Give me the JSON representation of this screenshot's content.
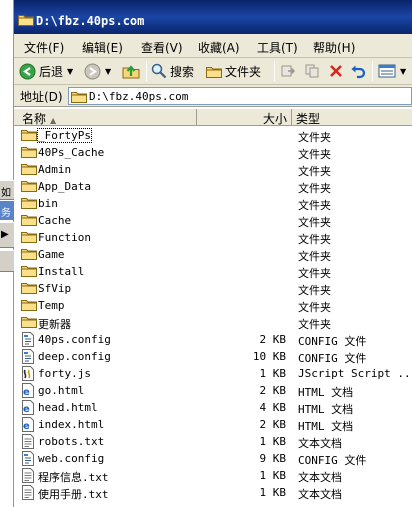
{
  "window": {
    "title": "D:\\fbz.40ps.com"
  },
  "background_strip": {
    "chars": [
      "如",
      "务"
    ]
  },
  "menu": [
    "文件(F)",
    "编辑(E)",
    "查看(V)",
    "收藏(A)",
    "工具(T)",
    "帮助(H)"
  ],
  "toolbar": {
    "back_label": "后退",
    "search_label": "搜索",
    "folders_label": "文件夹"
  },
  "address": {
    "label": "地址(D)",
    "value": "D:\\fbz.40ps.com"
  },
  "columns": {
    "name": "名称",
    "size": "大小",
    "type": "类型"
  },
  "files": [
    {
      "name": "_FortyPs",
      "size": "",
      "type": "文件夹",
      "icon": "folder-icon"
    },
    {
      "name": "40Ps_Cache",
      "size": "",
      "type": "文件夹",
      "icon": "folder-icon"
    },
    {
      "name": "Admin",
      "size": "",
      "type": "文件夹",
      "icon": "folder-icon"
    },
    {
      "name": "App_Data",
      "size": "",
      "type": "文件夹",
      "icon": "folder-icon"
    },
    {
      "name": "bin",
      "size": "",
      "type": "文件夹",
      "icon": "folder-icon"
    },
    {
      "name": "Cache",
      "size": "",
      "type": "文件夹",
      "icon": "folder-icon"
    },
    {
      "name": "Function",
      "size": "",
      "type": "文件夹",
      "icon": "folder-icon"
    },
    {
      "name": "Game",
      "size": "",
      "type": "文件夹",
      "icon": "folder-icon"
    },
    {
      "name": "Install",
      "size": "",
      "type": "文件夹",
      "icon": "folder-icon"
    },
    {
      "name": "SfVip",
      "size": "",
      "type": "文件夹",
      "icon": "folder-icon"
    },
    {
      "name": "Temp",
      "size": "",
      "type": "文件夹",
      "icon": "folder-icon"
    },
    {
      "name": "更新器",
      "size": "",
      "type": "文件夹",
      "icon": "folder-icon"
    },
    {
      "name": "40ps.config",
      "size": "2 KB",
      "type": "CONFIG 文件",
      "icon": "config-file-icon"
    },
    {
      "name": "deep.config",
      "size": "10 KB",
      "type": "CONFIG 文件",
      "icon": "config-file-icon"
    },
    {
      "name": "forty.js",
      "size": "1 KB",
      "type": "JScript Script ...",
      "icon": "script-file-icon"
    },
    {
      "name": "go.html",
      "size": "2 KB",
      "type": "HTML 文档",
      "icon": "html-file-icon"
    },
    {
      "name": "head.html",
      "size": "4 KB",
      "type": "HTML 文档",
      "icon": "html-file-icon"
    },
    {
      "name": "index.html",
      "size": "2 KB",
      "type": "HTML 文档",
      "icon": "html-file-icon"
    },
    {
      "name": "robots.txt",
      "size": "1 KB",
      "type": "文本文档",
      "icon": "text-file-icon"
    },
    {
      "name": "web.config",
      "size": "9 KB",
      "type": "CONFIG 文件",
      "icon": "config-file-icon"
    },
    {
      "name": "程序信息.txt",
      "size": "1 KB",
      "type": "文本文档",
      "icon": "text-file-icon"
    },
    {
      "name": "使用手册.txt",
      "size": "1 KB",
      "type": "文本文档",
      "icon": "text-file-icon"
    }
  ]
}
